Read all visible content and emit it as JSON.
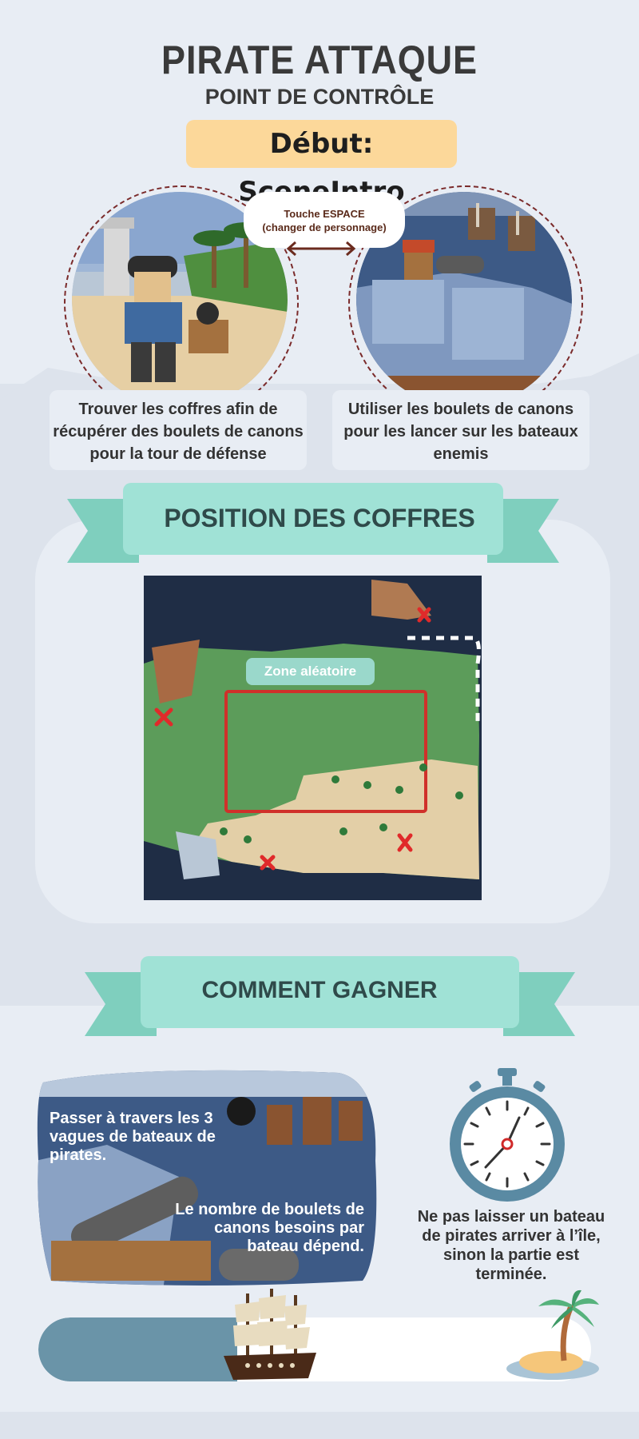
{
  "header": {
    "title": "PIRATE ATTAQUE",
    "subtitle": "POINT DE CONTRÔLE",
    "start_label": "Début: SceneIntro"
  },
  "characters": {
    "switch_key_line1": "Touche ESPACE",
    "switch_key_line2": "(changer de personnage)",
    "left_description": "Trouver les coffres afin de récupérer des boulets de canons pour la tour de défense",
    "right_description": "Utiliser les boulets de canons pour les lancer sur les bateaux enemis"
  },
  "chests_section": {
    "heading": "POSITION DES COFFRES",
    "zone_label": "Zone aléatoire"
  },
  "win_section": {
    "heading": "COMMENT GAGNER",
    "waves_text": "Passer à travers les 3 vagues de bateaux de pirates.",
    "cannonballs_text": "Le nombre de boulets de canons besoins par bateau dépend.",
    "lose_condition": "Ne pas laisser un bateau de pirates arriver à l’île, sinon la partie est terminée."
  },
  "progress": {
    "ship_progress": 0.36
  },
  "icons": [
    "stopwatch-icon",
    "pirate-ship-icon",
    "palm-island-icon",
    "double-arrow-icon",
    "chest-marker-icon"
  ],
  "colors": {
    "banner": "#a0e2d6",
    "banner_tail": "#7fcfbe",
    "start_badge": "#fcd89a",
    "marker_red": "#e02a2a",
    "stopwatch": "#5a8aa3",
    "track_fill": "#6a94a8"
  }
}
